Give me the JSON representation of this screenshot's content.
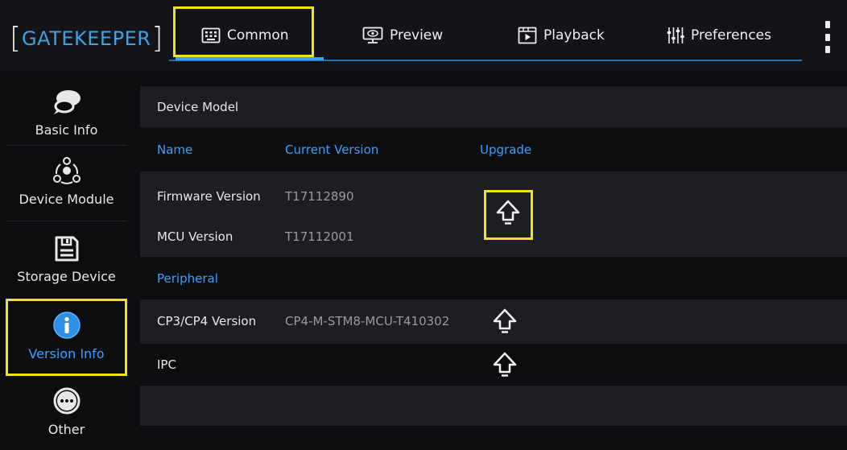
{
  "app": {
    "logo_left_bracket": "[",
    "logo_text": "GATEKEEPER",
    "logo_right_bracket": "]"
  },
  "tabs": [
    {
      "label": "Common",
      "icon": "keyboard-icon",
      "active": true
    },
    {
      "label": "Preview",
      "icon": "monitor-eye-icon",
      "active": false
    },
    {
      "label": "Playback",
      "icon": "film-play-icon",
      "active": false
    },
    {
      "label": "Preferences",
      "icon": "sliders-icon",
      "active": false
    }
  ],
  "sidebar": {
    "items": [
      {
        "label": "Basic Info",
        "icon": "chat-bubble-icon",
        "active": false
      },
      {
        "label": "Device Module",
        "icon": "module-nodes-icon",
        "active": false
      },
      {
        "label": "Storage Device",
        "icon": "floppy-disk-icon",
        "active": false
      },
      {
        "label": "Version Info",
        "icon": "info-circle-icon",
        "active": true
      },
      {
        "label": "Other",
        "icon": "more-circle-icon",
        "active": false
      }
    ]
  },
  "main": {
    "device_model_label": "Device Model",
    "columns": {
      "name": "Name",
      "current_version": "Current Version",
      "upgrade": "Upgrade"
    },
    "firmware": {
      "name": "Firmware Version",
      "version": "T17112890"
    },
    "mcu": {
      "name": "MCU Version",
      "version": "T17112001"
    },
    "peripheral_label": "Peripheral",
    "cp": {
      "name": "CP3/CP4 Version",
      "version": "CP4-M-STM8-MCU-T410302"
    },
    "ipc": {
      "name": "IPC",
      "version": ""
    }
  },
  "colors": {
    "accent": "#3aa0ff",
    "highlight": "#f4e21a",
    "row_light": "#1c1e22",
    "background": "#0c0d0f"
  }
}
